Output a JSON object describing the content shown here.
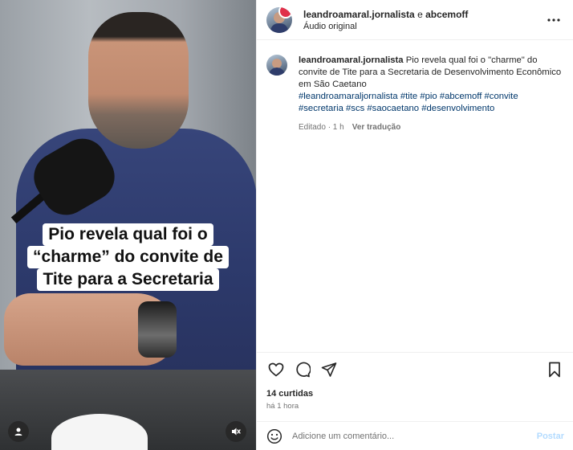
{
  "media": {
    "caption_lines": [
      "Pio revela qual foi o",
      "“charme” do convite de",
      "Tite para a Secretaria"
    ],
    "controls": {
      "left_icon": "tag-user-icon",
      "right_icon": "muted-audio-icon"
    }
  },
  "header": {
    "username": "leandroamaral.jornalista",
    "joiner": " e ",
    "collaborator": "abcemoff",
    "subtitle": "Áudio original",
    "more_icon": "more-options-icon"
  },
  "post": {
    "username": "leandroamaral.jornalista",
    "text": "Pio revela qual foi o \"charme\" do convite de Tite para a Secretaria de Desenvolvimento Econômico em São Caetano",
    "hashtags": "#leandroamaraljornalista #tite #pio #abcemoff #convite #secretaria #scs #saocaetano #desenvolvimento",
    "edited": "Editado · 1 h",
    "translate": "Ver tradução"
  },
  "actions": {
    "icons": [
      "heart-icon",
      "comment-icon",
      "share-icon",
      "bookmark-icon"
    ],
    "likes": "14 curtidas",
    "time": "há 1 hora"
  },
  "comment": {
    "placeholder": "Adicione um comentário...",
    "post_label": "Postar",
    "emoji_icon": "emoji-icon"
  },
  "colors": {
    "link": "#00376b",
    "muted": "#737373",
    "post_button": "#b3dbff"
  }
}
